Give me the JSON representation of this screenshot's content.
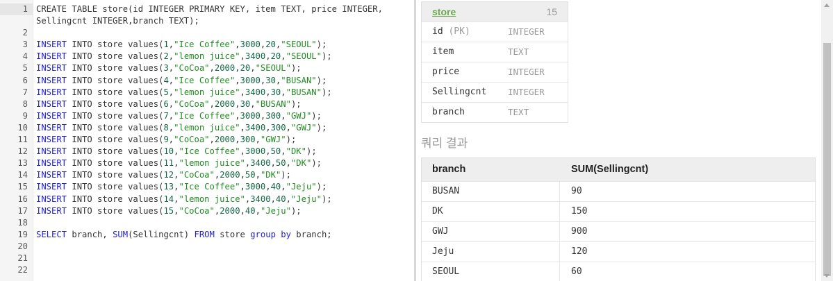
{
  "editor": {
    "lines": [
      {
        "n": "1",
        "active": true,
        "wrap": true,
        "tokens": [
          {
            "t": "CREATE TABLE store(id INTEGER PRIMARY KEY, item TEXT, price INTEGER, Sellingcnt INTEGER,branch TEXT);",
            "c": ""
          }
        ]
      },
      {
        "n": "2",
        "tokens": []
      },
      {
        "n": "3",
        "tokens": [
          {
            "t": "INSERT",
            "c": "kw"
          },
          {
            "t": " INTO store values(",
            "c": ""
          },
          {
            "t": "1",
            "c": "num"
          },
          {
            "t": ",",
            "c": ""
          },
          {
            "t": "\"Ice Coffee\"",
            "c": "str"
          },
          {
            "t": ",",
            "c": ""
          },
          {
            "t": "3000",
            "c": "num"
          },
          {
            "t": ",",
            "c": ""
          },
          {
            "t": "20",
            "c": "num"
          },
          {
            "t": ",",
            "c": ""
          },
          {
            "t": "\"SEOUL\"",
            "c": "str"
          },
          {
            "t": ");",
            "c": ""
          }
        ]
      },
      {
        "n": "4",
        "tokens": [
          {
            "t": "INSERT",
            "c": "kw"
          },
          {
            "t": " INTO store values(",
            "c": ""
          },
          {
            "t": "2",
            "c": "num"
          },
          {
            "t": ",",
            "c": ""
          },
          {
            "t": "\"lemon juice\"",
            "c": "str"
          },
          {
            "t": ",",
            "c": ""
          },
          {
            "t": "3400",
            "c": "num"
          },
          {
            "t": ",",
            "c": ""
          },
          {
            "t": "20",
            "c": "num"
          },
          {
            "t": ",",
            "c": ""
          },
          {
            "t": "\"SEOUL\"",
            "c": "str"
          },
          {
            "t": ");",
            "c": ""
          }
        ]
      },
      {
        "n": "5",
        "tokens": [
          {
            "t": "INSERT",
            "c": "kw"
          },
          {
            "t": " INTO store values(",
            "c": ""
          },
          {
            "t": "3",
            "c": "num"
          },
          {
            "t": ",",
            "c": ""
          },
          {
            "t": "\"CoCoa\"",
            "c": "str"
          },
          {
            "t": ",",
            "c": ""
          },
          {
            "t": "2000",
            "c": "num"
          },
          {
            "t": ",",
            "c": ""
          },
          {
            "t": "20",
            "c": "num"
          },
          {
            "t": ",",
            "c": ""
          },
          {
            "t": "\"SEOUL\"",
            "c": "str"
          },
          {
            "t": ");",
            "c": ""
          }
        ]
      },
      {
        "n": "6",
        "tokens": [
          {
            "t": "INSERT",
            "c": "kw"
          },
          {
            "t": " INTO store values(",
            "c": ""
          },
          {
            "t": "4",
            "c": "num"
          },
          {
            "t": ",",
            "c": ""
          },
          {
            "t": "\"Ice Coffee\"",
            "c": "str"
          },
          {
            "t": ",",
            "c": ""
          },
          {
            "t": "3000",
            "c": "num"
          },
          {
            "t": ",",
            "c": ""
          },
          {
            "t": "30",
            "c": "num"
          },
          {
            "t": ",",
            "c": ""
          },
          {
            "t": "\"BUSAN\"",
            "c": "str"
          },
          {
            "t": ");",
            "c": ""
          }
        ]
      },
      {
        "n": "7",
        "tokens": [
          {
            "t": "INSERT",
            "c": "kw"
          },
          {
            "t": " INTO store values(",
            "c": ""
          },
          {
            "t": "5",
            "c": "num"
          },
          {
            "t": ",",
            "c": ""
          },
          {
            "t": "\"lemon juice\"",
            "c": "str"
          },
          {
            "t": ",",
            "c": ""
          },
          {
            "t": "3400",
            "c": "num"
          },
          {
            "t": ",",
            "c": ""
          },
          {
            "t": "30",
            "c": "num"
          },
          {
            "t": ",",
            "c": ""
          },
          {
            "t": "\"BUSAN\"",
            "c": "str"
          },
          {
            "t": ");",
            "c": ""
          }
        ]
      },
      {
        "n": "8",
        "tokens": [
          {
            "t": "INSERT",
            "c": "kw"
          },
          {
            "t": " INTO store values(",
            "c": ""
          },
          {
            "t": "6",
            "c": "num"
          },
          {
            "t": ",",
            "c": ""
          },
          {
            "t": "\"CoCoa\"",
            "c": "str"
          },
          {
            "t": ",",
            "c": ""
          },
          {
            "t": "2000",
            "c": "num"
          },
          {
            "t": ",",
            "c": ""
          },
          {
            "t": "30",
            "c": "num"
          },
          {
            "t": ",",
            "c": ""
          },
          {
            "t": "\"BUSAN\"",
            "c": "str"
          },
          {
            "t": ");",
            "c": ""
          }
        ]
      },
      {
        "n": "9",
        "tokens": [
          {
            "t": "INSERT",
            "c": "kw"
          },
          {
            "t": " INTO store values(",
            "c": ""
          },
          {
            "t": "7",
            "c": "num"
          },
          {
            "t": ",",
            "c": ""
          },
          {
            "t": "\"Ice Coffee\"",
            "c": "str"
          },
          {
            "t": ",",
            "c": ""
          },
          {
            "t": "3000",
            "c": "num"
          },
          {
            "t": ",",
            "c": ""
          },
          {
            "t": "300",
            "c": "num"
          },
          {
            "t": ",",
            "c": ""
          },
          {
            "t": "\"GWJ\"",
            "c": "str"
          },
          {
            "t": ");",
            "c": ""
          }
        ]
      },
      {
        "n": "10",
        "tokens": [
          {
            "t": "INSERT",
            "c": "kw"
          },
          {
            "t": " INTO store values(",
            "c": ""
          },
          {
            "t": "8",
            "c": "num"
          },
          {
            "t": ",",
            "c": ""
          },
          {
            "t": "\"lemon juice\"",
            "c": "str"
          },
          {
            "t": ",",
            "c": ""
          },
          {
            "t": "3400",
            "c": "num"
          },
          {
            "t": ",",
            "c": ""
          },
          {
            "t": "300",
            "c": "num"
          },
          {
            "t": ",",
            "c": ""
          },
          {
            "t": "\"GWJ\"",
            "c": "str"
          },
          {
            "t": ");",
            "c": ""
          }
        ]
      },
      {
        "n": "11",
        "tokens": [
          {
            "t": "INSERT",
            "c": "kw"
          },
          {
            "t": " INTO store values(",
            "c": ""
          },
          {
            "t": "9",
            "c": "num"
          },
          {
            "t": ",",
            "c": ""
          },
          {
            "t": "\"CoCoa\"",
            "c": "str"
          },
          {
            "t": ",",
            "c": ""
          },
          {
            "t": "2000",
            "c": "num"
          },
          {
            "t": ",",
            "c": ""
          },
          {
            "t": "300",
            "c": "num"
          },
          {
            "t": ",",
            "c": ""
          },
          {
            "t": "\"GWJ\"",
            "c": "str"
          },
          {
            "t": ");",
            "c": ""
          }
        ]
      },
      {
        "n": "12",
        "tokens": [
          {
            "t": "INSERT",
            "c": "kw"
          },
          {
            "t": " INTO store values(",
            "c": ""
          },
          {
            "t": "10",
            "c": "num"
          },
          {
            "t": ",",
            "c": ""
          },
          {
            "t": "\"Ice Coffee\"",
            "c": "str"
          },
          {
            "t": ",",
            "c": ""
          },
          {
            "t": "3000",
            "c": "num"
          },
          {
            "t": ",",
            "c": ""
          },
          {
            "t": "50",
            "c": "num"
          },
          {
            "t": ",",
            "c": ""
          },
          {
            "t": "\"DK\"",
            "c": "str"
          },
          {
            "t": ");",
            "c": ""
          }
        ]
      },
      {
        "n": "13",
        "tokens": [
          {
            "t": "INSERT",
            "c": "kw"
          },
          {
            "t": " INTO store values(",
            "c": ""
          },
          {
            "t": "11",
            "c": "num"
          },
          {
            "t": ",",
            "c": ""
          },
          {
            "t": "\"lemon juice\"",
            "c": "str"
          },
          {
            "t": ",",
            "c": ""
          },
          {
            "t": "3400",
            "c": "num"
          },
          {
            "t": ",",
            "c": ""
          },
          {
            "t": "50",
            "c": "num"
          },
          {
            "t": ",",
            "c": ""
          },
          {
            "t": "\"DK\"",
            "c": "str"
          },
          {
            "t": ");",
            "c": ""
          }
        ]
      },
      {
        "n": "14",
        "tokens": [
          {
            "t": "INSERT",
            "c": "kw"
          },
          {
            "t": " INTO store values(",
            "c": ""
          },
          {
            "t": "12",
            "c": "num"
          },
          {
            "t": ",",
            "c": ""
          },
          {
            "t": "\"CoCoa\"",
            "c": "str"
          },
          {
            "t": ",",
            "c": ""
          },
          {
            "t": "2000",
            "c": "num"
          },
          {
            "t": ",",
            "c": ""
          },
          {
            "t": "50",
            "c": "num"
          },
          {
            "t": ",",
            "c": ""
          },
          {
            "t": "\"DK\"",
            "c": "str"
          },
          {
            "t": ");",
            "c": ""
          }
        ]
      },
      {
        "n": "15",
        "tokens": [
          {
            "t": "INSERT",
            "c": "kw"
          },
          {
            "t": " INTO store values(",
            "c": ""
          },
          {
            "t": "13",
            "c": "num"
          },
          {
            "t": ",",
            "c": ""
          },
          {
            "t": "\"Ice Coffee\"",
            "c": "str"
          },
          {
            "t": ",",
            "c": ""
          },
          {
            "t": "3000",
            "c": "num"
          },
          {
            "t": ",",
            "c": ""
          },
          {
            "t": "40",
            "c": "num"
          },
          {
            "t": ",",
            "c": ""
          },
          {
            "t": "\"Jeju\"",
            "c": "str"
          },
          {
            "t": ");",
            "c": ""
          }
        ]
      },
      {
        "n": "16",
        "tokens": [
          {
            "t": "INSERT",
            "c": "kw"
          },
          {
            "t": " INTO store values(",
            "c": ""
          },
          {
            "t": "14",
            "c": "num"
          },
          {
            "t": ",",
            "c": ""
          },
          {
            "t": "\"lemon juice\"",
            "c": "str"
          },
          {
            "t": ",",
            "c": ""
          },
          {
            "t": "3400",
            "c": "num"
          },
          {
            "t": ",",
            "c": ""
          },
          {
            "t": "40",
            "c": "num"
          },
          {
            "t": ",",
            "c": ""
          },
          {
            "t": "\"Jeju\"",
            "c": "str"
          },
          {
            "t": ");",
            "c": ""
          }
        ]
      },
      {
        "n": "17",
        "tokens": [
          {
            "t": "INSERT",
            "c": "kw"
          },
          {
            "t": " INTO store values(",
            "c": ""
          },
          {
            "t": "15",
            "c": "num"
          },
          {
            "t": ",",
            "c": ""
          },
          {
            "t": "\"CoCoa\"",
            "c": "str"
          },
          {
            "t": ",",
            "c": ""
          },
          {
            "t": "2000",
            "c": "num"
          },
          {
            "t": ",",
            "c": ""
          },
          {
            "t": "40",
            "c": "num"
          },
          {
            "t": ",",
            "c": ""
          },
          {
            "t": "\"Jeju\"",
            "c": "str"
          },
          {
            "t": ");",
            "c": ""
          }
        ]
      },
      {
        "n": "18",
        "tokens": []
      },
      {
        "n": "19",
        "tokens": [
          {
            "t": "SELECT",
            "c": "kw"
          },
          {
            "t": " branch, ",
            "c": ""
          },
          {
            "t": "SUM",
            "c": "kw"
          },
          {
            "t": "(Sellingcnt) ",
            "c": ""
          },
          {
            "t": "FROM",
            "c": "kw"
          },
          {
            "t": " store ",
            "c": ""
          },
          {
            "t": "group by",
            "c": "kw"
          },
          {
            "t": " branch;",
            "c": ""
          }
        ]
      },
      {
        "n": "20",
        "tokens": []
      },
      {
        "n": "21",
        "tokens": []
      },
      {
        "n": "22",
        "tokens": []
      }
    ]
  },
  "schema": {
    "table_name": "store",
    "row_count": "15",
    "columns": [
      {
        "name": "id",
        "pk": "(PK)",
        "type": "INTEGER"
      },
      {
        "name": "item",
        "pk": "",
        "type": "TEXT"
      },
      {
        "name": "price",
        "pk": "",
        "type": "INTEGER"
      },
      {
        "name": "Sellingcnt",
        "pk": "",
        "type": "INTEGER"
      },
      {
        "name": "branch",
        "pk": "",
        "type": "TEXT"
      }
    ]
  },
  "result": {
    "title": "쿼리 결과",
    "headers": [
      "branch",
      "SUM(Sellingcnt)"
    ],
    "rows": [
      [
        "BUSAN",
        "90"
      ],
      [
        "DK",
        "150"
      ],
      [
        "GWJ",
        "900"
      ],
      [
        "Jeju",
        "120"
      ],
      [
        "SEOUL",
        "60"
      ]
    ]
  }
}
